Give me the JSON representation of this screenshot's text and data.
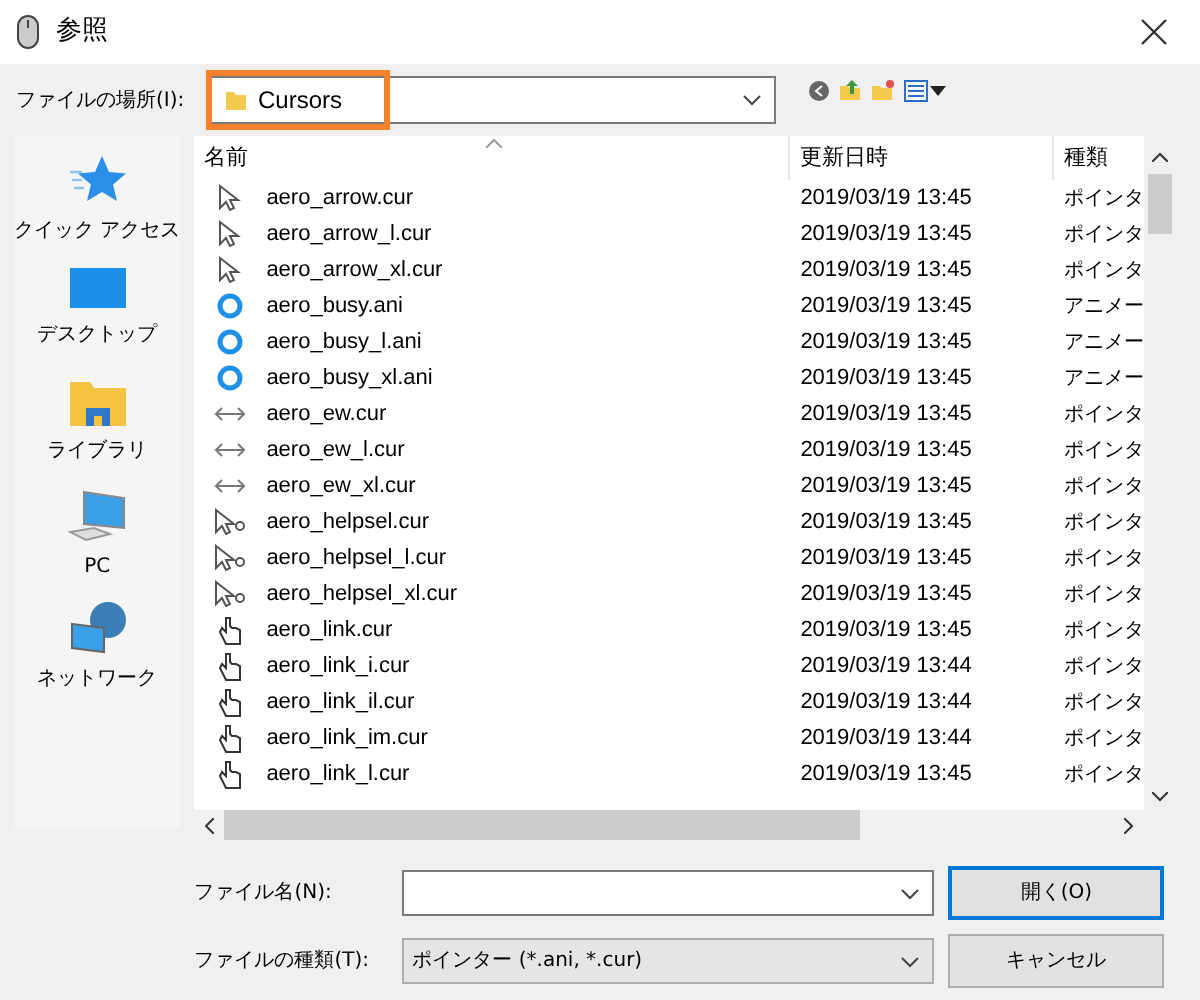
{
  "window": {
    "title": "参照"
  },
  "location": {
    "label": "ファイルの場所(I):",
    "value": "Cursors",
    "highlighted": true
  },
  "sidebar": {
    "items": [
      {
        "label": "クイック アクセス",
        "kind": "star"
      },
      {
        "label": "デスクトップ",
        "kind": "desktop"
      },
      {
        "label": "ライブラリ",
        "kind": "library"
      },
      {
        "label": "PC",
        "kind": "pc"
      },
      {
        "label": "ネットワーク",
        "kind": "network"
      }
    ]
  },
  "table": {
    "columns": [
      "名前",
      "更新日時",
      "種類"
    ],
    "rows": [
      {
        "kind": "arrow",
        "name": "aero_arrow.cur",
        "date": "2019/03/19 13:45",
        "type": "ポインタ"
      },
      {
        "kind": "arrow",
        "name": "aero_arrow_l.cur",
        "date": "2019/03/19 13:45",
        "type": "ポインタ"
      },
      {
        "kind": "arrow",
        "name": "aero_arrow_xl.cur",
        "date": "2019/03/19 13:45",
        "type": "ポインタ"
      },
      {
        "kind": "busy",
        "name": "aero_busy.ani",
        "date": "2019/03/19 13:45",
        "type": "アニメー"
      },
      {
        "kind": "busy",
        "name": "aero_busy_l.ani",
        "date": "2019/03/19 13:45",
        "type": "アニメー"
      },
      {
        "kind": "busy",
        "name": "aero_busy_xl.ani",
        "date": "2019/03/19 13:45",
        "type": "アニメー"
      },
      {
        "kind": "ew",
        "name": "aero_ew.cur",
        "date": "2019/03/19 13:45",
        "type": "ポインタ"
      },
      {
        "kind": "ew",
        "name": "aero_ew_l.cur",
        "date": "2019/03/19 13:45",
        "type": "ポインタ"
      },
      {
        "kind": "ew",
        "name": "aero_ew_xl.cur",
        "date": "2019/03/19 13:45",
        "type": "ポインタ"
      },
      {
        "kind": "helpsel",
        "name": "aero_helpsel.cur",
        "date": "2019/03/19 13:45",
        "type": "ポインタ"
      },
      {
        "kind": "helpsel",
        "name": "aero_helpsel_l.cur",
        "date": "2019/03/19 13:45",
        "type": "ポインタ"
      },
      {
        "kind": "helpsel",
        "name": "aero_helpsel_xl.cur",
        "date": "2019/03/19 13:45",
        "type": "ポインタ"
      },
      {
        "kind": "link",
        "name": "aero_link.cur",
        "date": "2019/03/19 13:45",
        "type": "ポインタ"
      },
      {
        "kind": "link",
        "name": "aero_link_i.cur",
        "date": "2019/03/19 13:44",
        "type": "ポインタ"
      },
      {
        "kind": "link",
        "name": "aero_link_il.cur",
        "date": "2019/03/19 13:44",
        "type": "ポインタ"
      },
      {
        "kind": "link",
        "name": "aero_link_im.cur",
        "date": "2019/03/19 13:44",
        "type": "ポインタ"
      },
      {
        "kind": "link",
        "name": "aero_link_l.cur",
        "date": "2019/03/19 13:45",
        "type": "ポインタ"
      }
    ]
  },
  "filename": {
    "label": "ファイル名(N):"
  },
  "filetype": {
    "label": "ファイルの種類(T):",
    "value": "ポインター (*.ani, *.cur)"
  },
  "buttons": [
    "開く(O)",
    "キャンセル"
  ]
}
